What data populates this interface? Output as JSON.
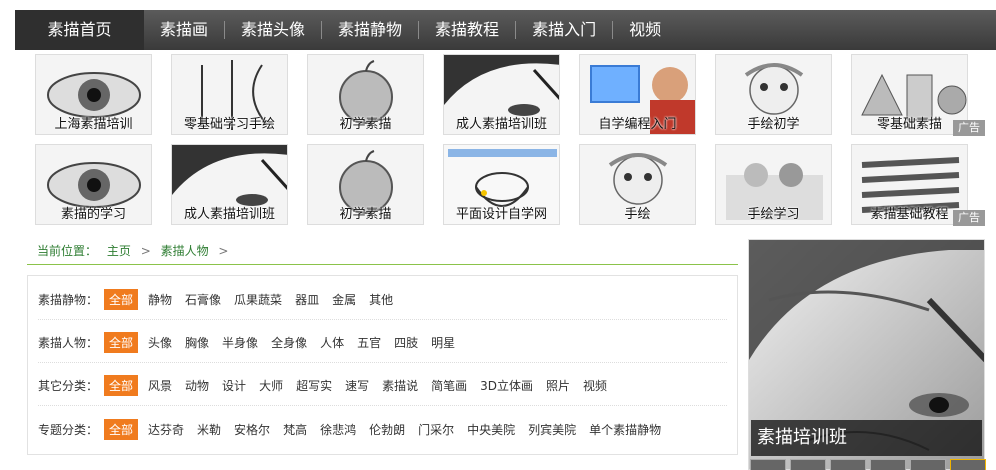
{
  "nav": {
    "items": [
      "素描首页",
      "素描画",
      "素描头像",
      "素描静物",
      "素描教程",
      "素描入门",
      "视频"
    ]
  },
  "ads": {
    "tag": "广告",
    "rows": [
      [
        "上海素描培训",
        "零基础学习手绘",
        "初学素描",
        "成人素描培训班",
        "自学编程入门",
        "手绘初学",
        "零基础素描"
      ],
      [
        "素描的学习",
        "成人素描培训班",
        "初学素描",
        "平面设计自学网",
        "手绘",
        "手绘学习",
        "素描基础教程"
      ]
    ]
  },
  "breadcrumb": {
    "prefix": "当前位置：",
    "home": "主页",
    "current": "素描人物",
    "sep": ">"
  },
  "filters": [
    {
      "label": "素描静物：",
      "all": "全部",
      "options": [
        "静物",
        "石膏像",
        "瓜果蔬菜",
        "器皿",
        "金属",
        "其他"
      ]
    },
    {
      "label": "素描人物：",
      "all": "全部",
      "options": [
        "头像",
        "胸像",
        "半身像",
        "全身像",
        "人体",
        "五官",
        "四肢",
        "明星"
      ]
    },
    {
      "label": "其它分类：",
      "all": "全部",
      "options": [
        "风景",
        "动物",
        "设计",
        "大师",
        "超写实",
        "速写",
        "素描说",
        "简笔画",
        "3D立体画",
        "照片",
        "视频"
      ]
    },
    {
      "label": "专题分类：",
      "all": "全部",
      "options": [
        "达芬奇",
        "米勒",
        "安格尔",
        "梵高",
        "徐悲鸿",
        "伦勃朗",
        "门采尔",
        "中央美院",
        "列宾美院",
        "单个素描静物"
      ]
    }
  ],
  "promo": {
    "title": "素描培训班"
  },
  "colors": {
    "nav_bg": "#444444",
    "accent_orange": "#f07b1e",
    "breadcrumb_green": "#2e7d32"
  }
}
